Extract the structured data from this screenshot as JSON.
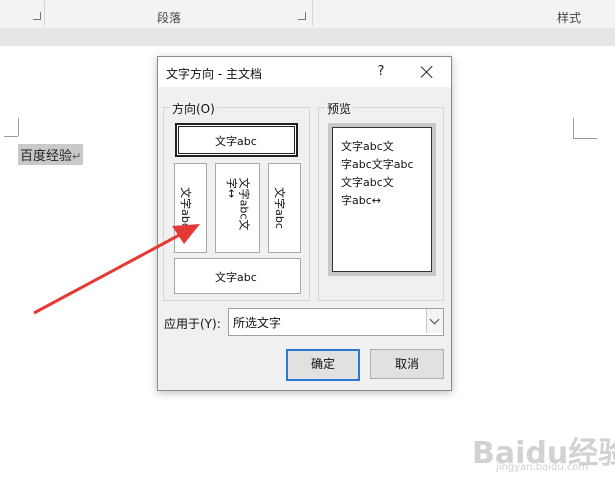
{
  "ribbon": {
    "group_paragraph": "段落",
    "group_styles": "样式"
  },
  "document": {
    "text": "百度经验",
    "para_mark": "↵"
  },
  "dialog": {
    "title": "文字方向 - 主文档",
    "help": "?",
    "direction_label": "方向(O)",
    "preview_label": "预览",
    "options": {
      "horizontal": "文字abc",
      "vertical_left": "文字abc",
      "vertical_stacked_a": "文字abc文",
      "vertical_stacked_b": "字↔",
      "vertical_right": "文字abc",
      "horizontal_rotated": "文字abc"
    },
    "preview_lines": [
      "文字abc文",
      "字abc文字abc",
      "文字abc文",
      "字abc↔"
    ],
    "apply_label": "应用于(Y):",
    "apply_value": "所选文字",
    "ok_button": "确定",
    "cancel_button": "取消"
  },
  "watermark": {
    "brand": "Baidu经验",
    "url": "jingyan.baidu.com"
  },
  "colors": {
    "accent": "#2b78d3",
    "arrow": "#e53935",
    "selection": "#c9c9c9"
  }
}
